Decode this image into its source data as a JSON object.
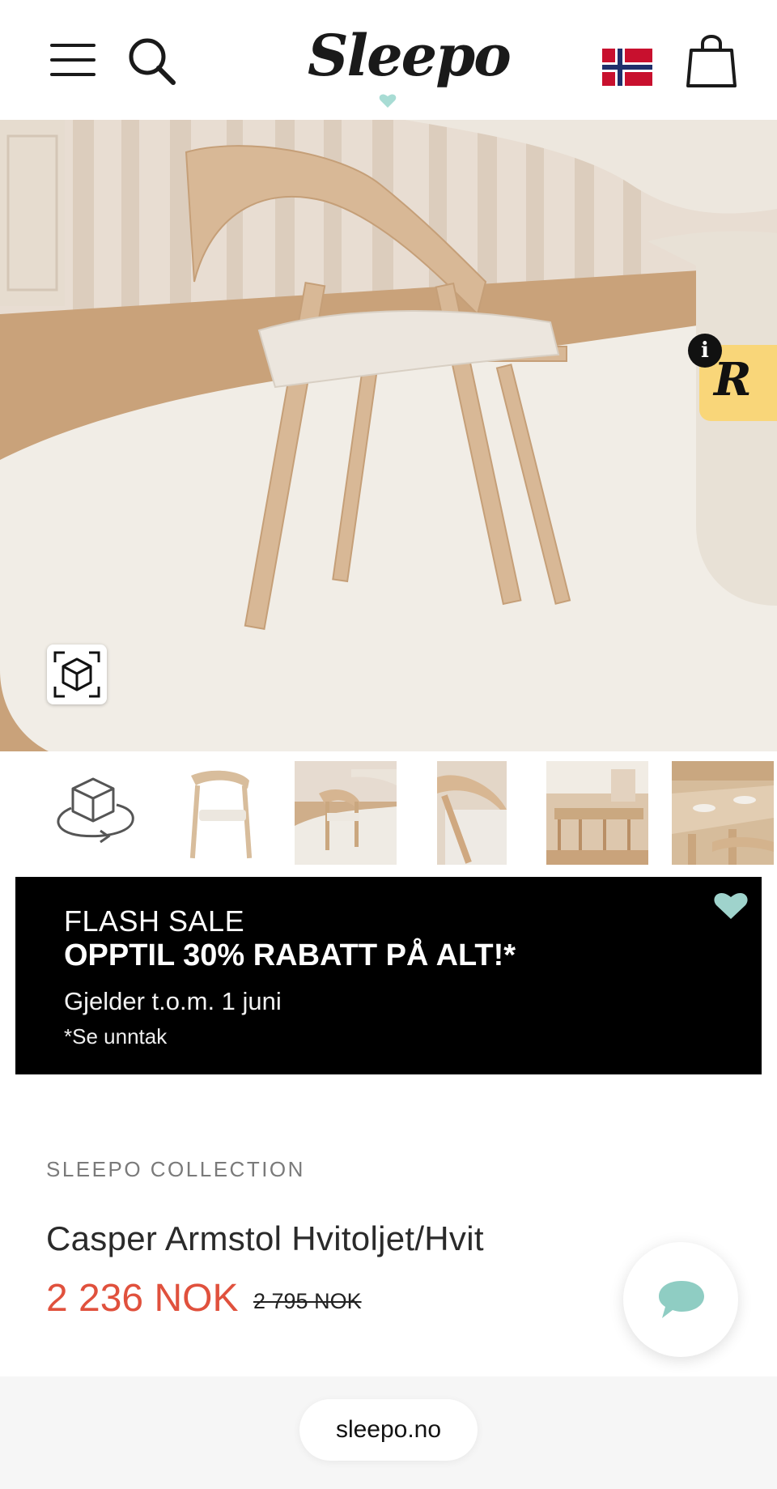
{
  "header": {
    "logo_text": "Sleepo",
    "menu_icon": "hamburger-menu-icon",
    "search_icon": "search-icon",
    "flag_icon": "norway-flag-icon",
    "cart_icon": "shopping-bag-icon"
  },
  "hero": {
    "ar_icon": "ar-cube-icon",
    "review_badge_letter": "R",
    "info_letter": "i"
  },
  "thumbnails": [
    {
      "kind": "3d-view",
      "icon": "3d-rotate-icon"
    },
    {
      "kind": "image",
      "label": "chair-cutout"
    },
    {
      "kind": "image",
      "label": "chair-on-rug"
    },
    {
      "kind": "image",
      "label": "chair-detail"
    },
    {
      "kind": "image",
      "label": "dining-room"
    },
    {
      "kind": "image",
      "label": "dining-table-closeup"
    }
  ],
  "banner": {
    "title": "FLASH SALE",
    "headline": "OPPTIL 30% RABATT PÅ ALT!*",
    "subtitle": "Gjelder t.o.m. 1 juni",
    "note": "*Se unntak",
    "heart_color": "#9fd3cc"
  },
  "product": {
    "collection": "SLEEPO COLLECTION",
    "title": "Casper Armstol Hvitoljet/Hvit",
    "price_now": "2 236 NOK",
    "price_old": "2 795 NOK",
    "price_color": "#e0513d"
  },
  "chat": {
    "icon": "chat-bubble-icon",
    "color": "#8fcdc3"
  },
  "browser": {
    "url": "sleepo.no"
  }
}
